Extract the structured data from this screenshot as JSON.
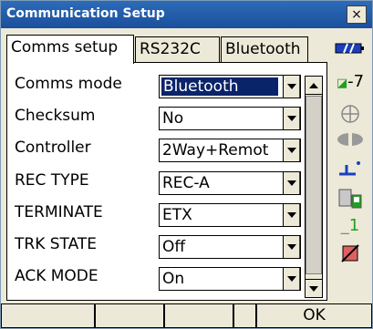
{
  "window": {
    "title": "Communication Setup",
    "close_label": "×"
  },
  "tabs": [
    {
      "label": "Comms setup"
    },
    {
      "label": "RS232C"
    },
    {
      "label": "Bluetooth"
    }
  ],
  "fields": [
    {
      "label": "Comms mode",
      "value": "Bluetooth"
    },
    {
      "label": "Checksum",
      "value": "No"
    },
    {
      "label": "Controller",
      "value": "2Way+Remot"
    },
    {
      "label": "REC TYPE",
      "value": "REC-A"
    },
    {
      "label": "TERMINATE",
      "value": "ETX"
    },
    {
      "label": "TRK STATE",
      "value": "Off"
    },
    {
      "label": "ACK MODE",
      "value": "On"
    }
  ],
  "status": {
    "battery_icon": "battery-icon",
    "prism_constant": "-7",
    "line_one": "1"
  },
  "softkeys": [
    "",
    "",
    "",
    "",
    "OK"
  ]
}
